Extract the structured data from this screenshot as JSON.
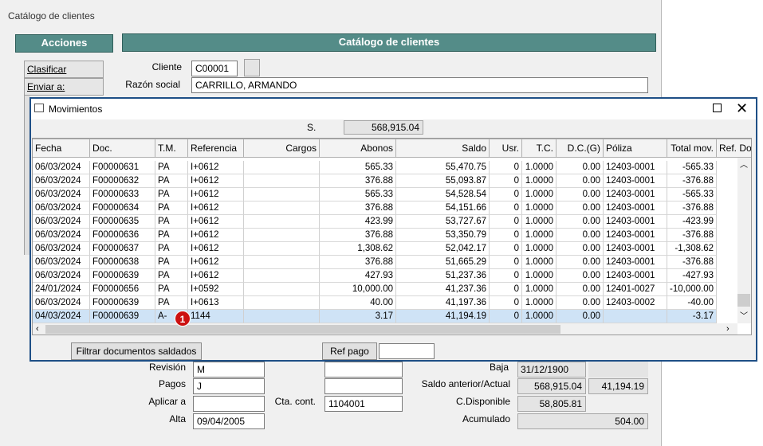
{
  "background_window": {
    "title": "Catálogo de clientes",
    "actions_header": "Acciones",
    "catalog_header": "Catálogo de clientes",
    "menu": [
      "Clasificar",
      "Enviar a:"
    ],
    "cliente_label": "Cliente",
    "cliente_value": "C00001",
    "razon_label": "Razón social",
    "razon_value": "CARRILLO, ARMANDO",
    "revision_label": "Revisión",
    "revision_value": "M",
    "pagos_label": "Pagos",
    "pagos_value": "J",
    "aplicar_label": "Aplicar a",
    "aplicar_value": "",
    "alta_label": "Alta",
    "alta_value": "09/04/2005",
    "cta_label": "Cta. cont.",
    "cta_value": "1104001",
    "baja_label": "Baja",
    "baja_value": "31/12/1900",
    "saldo_label": "Saldo anterior/Actual",
    "saldo_anterior": "568,915.04",
    "saldo_actual": "41,194.19",
    "disponible_label": "C.Disponible",
    "disponible_value": "58,805.81",
    "acumulado_label": "Acumulado",
    "acumulado_value": "504.00"
  },
  "dialog": {
    "title": "Movimientos",
    "s_label": "S.",
    "s_value": "568,915.04",
    "columns": [
      "Fecha",
      "Doc.",
      "T.M.",
      "Referencia",
      "Cargos",
      "Abonos",
      "Saldo",
      "Usr.",
      "T.C.",
      "D.C.(G)",
      "Póliza",
      "Total mov.",
      "Ref. Do"
    ],
    "rows": [
      [
        "06/03/2024",
        "F00000631",
        "PA",
        "I+0612",
        "",
        "565.33",
        "55,470.75",
        "0",
        "1.0000",
        "0.00",
        "12403-0001",
        "-565.33"
      ],
      [
        "06/03/2024",
        "F00000632",
        "PA",
        "I+0612",
        "",
        "376.88",
        "55,093.87",
        "0",
        "1.0000",
        "0.00",
        "12403-0001",
        "-376.88"
      ],
      [
        "06/03/2024",
        "F00000633",
        "PA",
        "I+0612",
        "",
        "565.33",
        "54,528.54",
        "0",
        "1.0000",
        "0.00",
        "12403-0001",
        "-565.33"
      ],
      [
        "06/03/2024",
        "F00000634",
        "PA",
        "I+0612",
        "",
        "376.88",
        "54,151.66",
        "0",
        "1.0000",
        "0.00",
        "12403-0001",
        "-376.88"
      ],
      [
        "06/03/2024",
        "F00000635",
        "PA",
        "I+0612",
        "",
        "423.99",
        "53,727.67",
        "0",
        "1.0000",
        "0.00",
        "12403-0001",
        "-423.99"
      ],
      [
        "06/03/2024",
        "F00000636",
        "PA",
        "I+0612",
        "",
        "376.88",
        "53,350.79",
        "0",
        "1.0000",
        "0.00",
        "12403-0001",
        "-376.88"
      ],
      [
        "06/03/2024",
        "F00000637",
        "PA",
        "I+0612",
        "",
        "1,308.62",
        "52,042.17",
        "0",
        "1.0000",
        "0.00",
        "12403-0001",
        "-1,308.62"
      ],
      [
        "06/03/2024",
        "F00000638",
        "PA",
        "I+0612",
        "",
        "376.88",
        "51,665.29",
        "0",
        "1.0000",
        "0.00",
        "12403-0001",
        "-376.88"
      ],
      [
        "06/03/2024",
        "F00000639",
        "PA",
        "I+0612",
        "",
        "427.93",
        "51,237.36",
        "0",
        "1.0000",
        "0.00",
        "12403-0001",
        "-427.93"
      ],
      [
        "24/01/2024",
        "F00000656",
        "PA",
        "I+0592",
        "",
        "10,000.00",
        "41,237.36",
        "0",
        "1.0000",
        "0.00",
        "12401-0027",
        "-10,000.00"
      ],
      [
        "06/03/2024",
        "F00000639",
        "PA",
        "I+0613",
        "",
        "40.00",
        "41,197.36",
        "0",
        "1.0000",
        "0.00",
        "12403-0002",
        "-40.00"
      ],
      [
        "04/03/2024",
        "F00000639",
        "A-",
        "1144",
        "",
        "3.17",
        "41,194.19",
        "0",
        "1.0000",
        "0.00",
        "",
        "-3.17"
      ]
    ],
    "filter_button": "Filtrar documentos saldados",
    "refpago_button": "Ref pago",
    "refpago_value": "",
    "badge": "1"
  },
  "colors": {
    "header": "#548c88",
    "dialog_border": "#1e4f86",
    "selection": "#cfe3f6",
    "badge": "#cc1111"
  }
}
